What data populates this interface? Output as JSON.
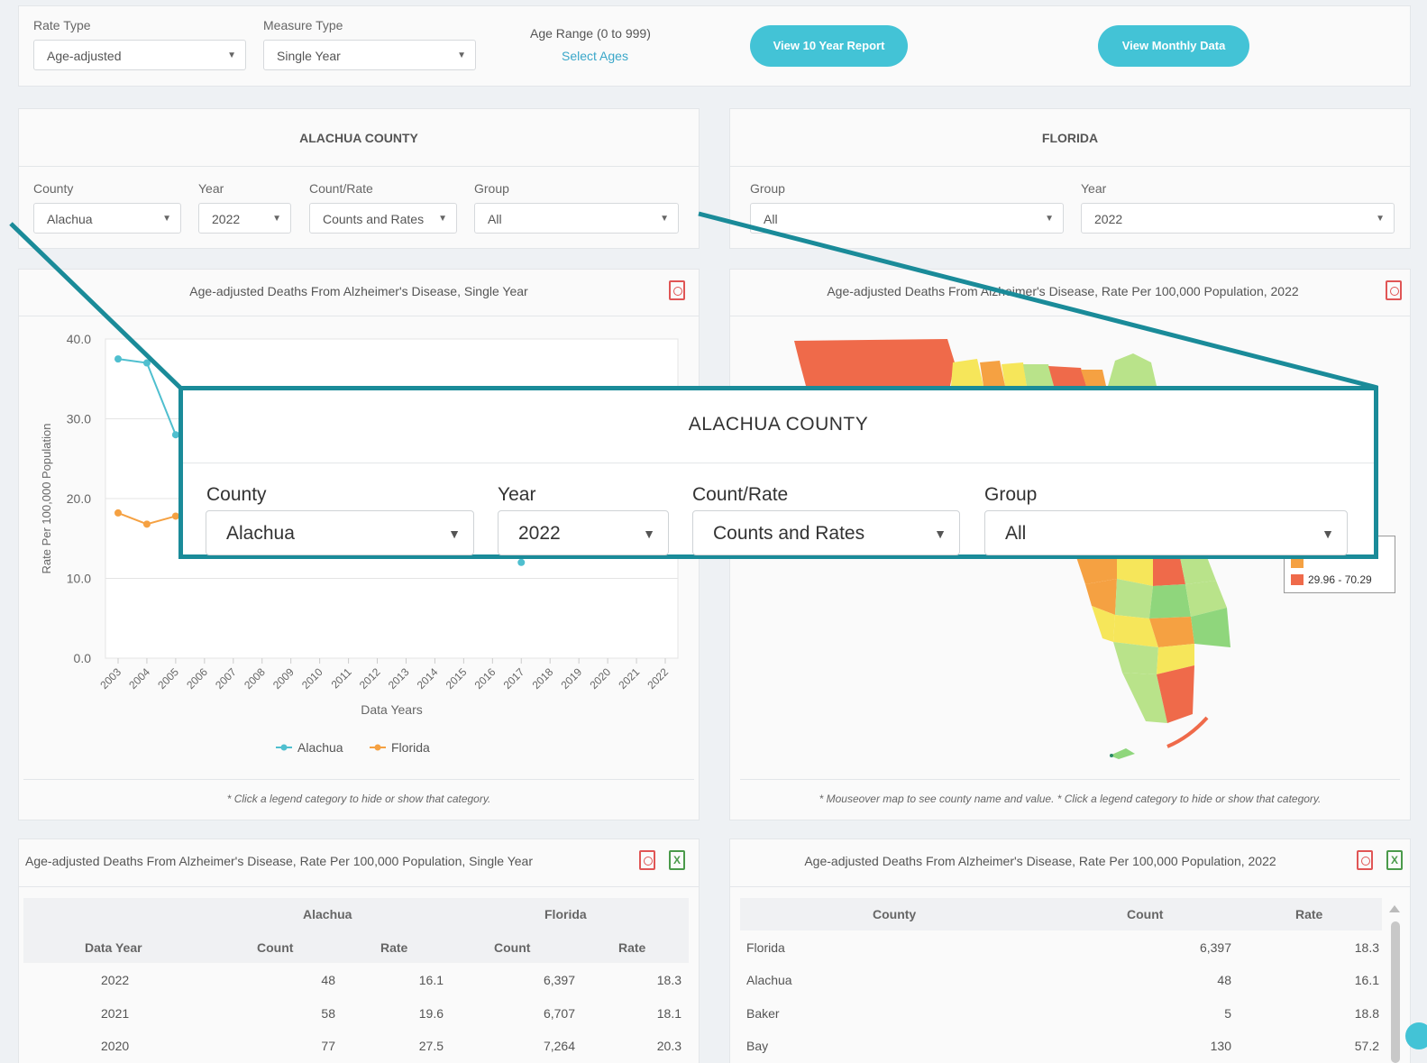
{
  "top": {
    "rate_type_label": "Rate Type",
    "rate_type_value": "Age-adjusted",
    "measure_type_label": "Measure Type",
    "measure_type_value": "Single Year",
    "age_range_label": "Age Range (0 to 999)",
    "select_ages": "Select Ages",
    "btn_10yr": "View 10 Year Report",
    "btn_monthly": "View Monthly Data"
  },
  "county_panel": {
    "title": "ALACHUA COUNTY",
    "county_label": "County",
    "county_value": "Alachua",
    "year_label": "Year",
    "year_value": "2022",
    "countrate_label": "Count/Rate",
    "countrate_value": "Counts and Rates",
    "group_label": "Group",
    "group_value": "All"
  },
  "florida_panel": {
    "title": "FLORIDA",
    "group_label": "Group",
    "group_value": "All",
    "year_label": "Year",
    "year_value": "2022"
  },
  "line_chart": {
    "title": "Age-adjusted Deaths From Alzheimer's Disease, Single Year",
    "note": "* Click a legend category to hide or show that category."
  },
  "map_chart": {
    "title": "Age-adjusted Deaths From Alzheimer's Disease, Rate Per 100,000 Population, 2022",
    "note": "* Mouseover map to see county name and value. * Click a legend category to hide or show that category.",
    "legend_last": "29.96 - 70.29",
    "colors": {
      "red": "#ef6a4a",
      "orange": "#f5a142",
      "yellow": "#f6e65a",
      "lightgreen": "#b9e38a",
      "green": "#8fd67c"
    }
  },
  "chart_data": {
    "type": "line",
    "ylabel": "Rate Per 100,000 Population",
    "xlabel": "Data Years",
    "ylim": [
      0,
      40
    ],
    "yticks": [
      "40.0",
      "30.0",
      "20.0",
      "10.0",
      "0.0"
    ],
    "x": [
      "2003",
      "2004",
      "2005",
      "2006",
      "2007",
      "2008",
      "2009",
      "2010",
      "2011",
      "2012",
      "2013",
      "2014",
      "2015",
      "2016",
      "2017",
      "2018",
      "2019",
      "2020",
      "2021",
      "2022"
    ],
    "series": [
      {
        "name": "Alachua",
        "color": "#4fbfcf",
        "values": [
          37.5,
          37.0,
          28.0,
          null,
          null,
          null,
          null,
          null,
          null,
          null,
          null,
          null,
          null,
          null,
          12.0,
          null,
          null,
          null,
          null,
          null
        ]
      },
      {
        "name": "Florida",
        "color": "#f5a142",
        "values": [
          18.2,
          16.8,
          17.8,
          null,
          null,
          null,
          null,
          null,
          null,
          null,
          null,
          null,
          null,
          null,
          null,
          null,
          null,
          null,
          null,
          null
        ]
      }
    ]
  },
  "table_left": {
    "title": "Age-adjusted Deaths From Alzheimer's Disease, Rate Per 100,000 Population, Single Year",
    "group_alachua": "Alachua",
    "group_florida": "Florida",
    "headers": [
      "Data Year",
      "Count",
      "Rate",
      "Count",
      "Rate"
    ],
    "rows": [
      [
        "2022",
        "48",
        "16.1",
        "6,397",
        "18.3"
      ],
      [
        "2021",
        "58",
        "19.6",
        "6,707",
        "18.1"
      ],
      [
        "2020",
        "77",
        "27.5",
        "7,264",
        "20.3"
      ]
    ]
  },
  "table_right": {
    "title": "Age-adjusted Deaths From Alzheimer's Disease, Rate Per 100,000 Population, 2022",
    "headers": [
      "County",
      "Count",
      "Rate"
    ],
    "rows": [
      [
        "Florida",
        "6,397",
        "18.3"
      ],
      [
        "Alachua",
        "48",
        "16.1"
      ],
      [
        "Baker",
        "5",
        "18.8"
      ],
      [
        "Bay",
        "130",
        "57.2"
      ]
    ]
  },
  "zoom": {
    "title": "ALACHUA COUNTY",
    "county_label": "County",
    "county_value": "Alachua",
    "year_label": "Year",
    "year_value": "2022",
    "countrate_label": "Count/Rate",
    "countrate_value": "Counts and Rates",
    "group_label": "Group",
    "group_value": "All"
  }
}
